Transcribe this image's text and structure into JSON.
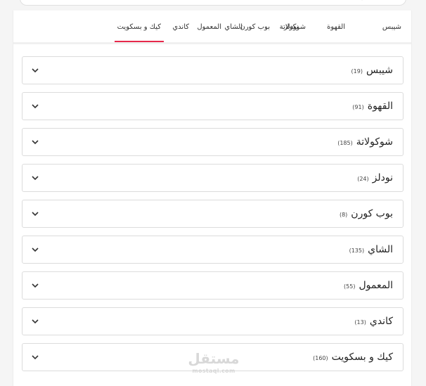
{
  "tabs": [
    {
      "label": "شيبس"
    },
    {
      "label": "القهوة"
    },
    {
      "label": "شوكولاتة"
    },
    {
      "label": "نودلز"
    },
    {
      "label": "بوب كورن"
    },
    {
      "label": "الشاي"
    },
    {
      "label": "المعمول"
    },
    {
      "label": "كاندي"
    },
    {
      "label": "كيك و بسكويت"
    }
  ],
  "active_tab": "كيك و بسكويت",
  "accordion": [
    {
      "title": "شيبس",
      "count": "19"
    },
    {
      "title": "القهوة",
      "count": "91"
    },
    {
      "title": "شوكولاتة",
      "count": "185"
    },
    {
      "title": "نودلز",
      "count": "24"
    },
    {
      "title": "بوب كورن",
      "count": "8"
    },
    {
      "title": "الشاي",
      "count": "135"
    },
    {
      "title": "المعمول",
      "count": "55"
    },
    {
      "title": "كاندي",
      "count": "13"
    },
    {
      "title": "كيك و بسكويت",
      "count": "160"
    }
  ],
  "watermark": {
    "arabic": "مستقل",
    "latin": "mostaql.com"
  },
  "colors": {
    "accent": "#e6294b",
    "border": "#dcdcdc",
    "text": "#222222"
  }
}
